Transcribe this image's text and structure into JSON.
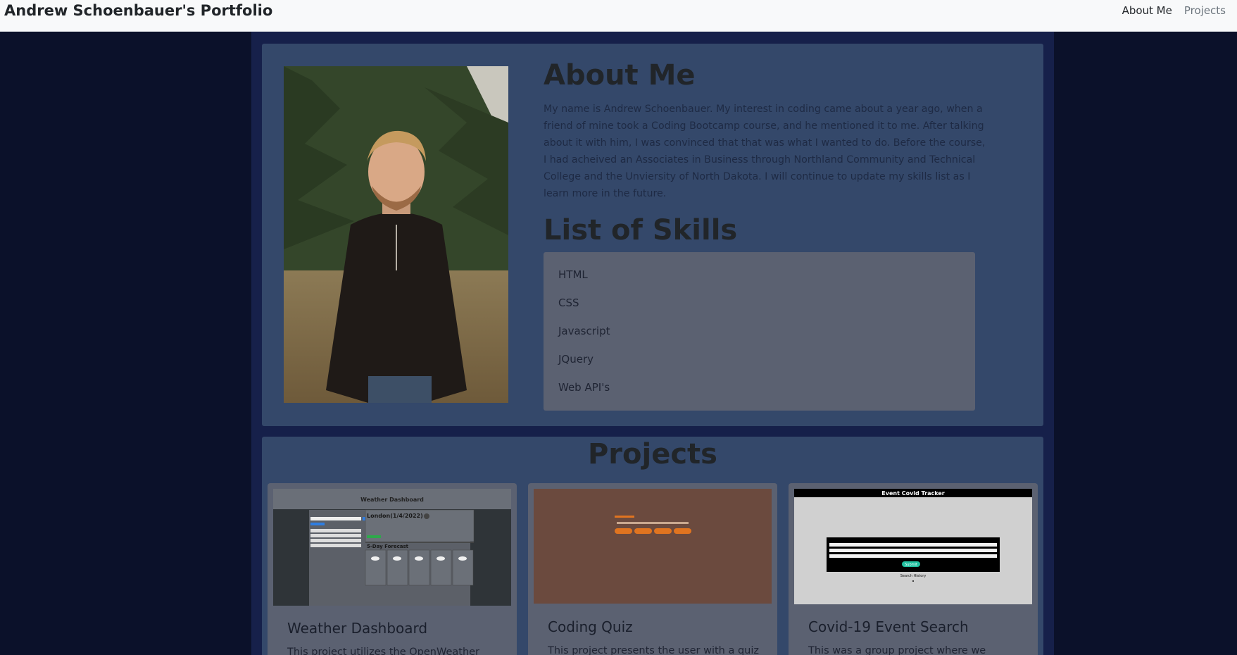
{
  "navbar": {
    "brand": "Andrew Schoenbauer's Portfolio",
    "links": [
      {
        "label": "About Me"
      },
      {
        "label": "Projects"
      }
    ]
  },
  "about": {
    "title": "About Me",
    "text": "My name is Andrew Schoenbauer. My interest in coding came about a year ago, when a friend of mine took a Coding Bootcamp course, and he mentioned it to me. After talking about it with him, I was convinced that that was what I wanted to do. Before the course, I had acheived an Associates in Business through Northland Community and Technical College and the Unviersity of North Dakota. I will continue to update my skills list as I learn more in the future."
  },
  "skills": {
    "title": "List of Skills",
    "items": [
      "HTML",
      "CSS",
      "Javascript",
      "JQuery",
      "Web API's"
    ]
  },
  "projects": {
    "title": "Projects",
    "cards": [
      {
        "title": "Weather Dashboard",
        "text": "This project utilizes the OpenWeather API",
        "preview": {
          "header": "Weather Dashboard",
          "city": "London(1/4/2022)",
          "forecast": "5-Day Forecast"
        }
      },
      {
        "title": "Coding Quiz",
        "text": "This project presents the user with a quiz"
      },
      {
        "title": "Covid-19 Event Search",
        "text": "This was a group project where we",
        "preview": {
          "header": "Event Covid Tracker",
          "history": "Search History",
          "button": "Submit"
        }
      }
    ]
  }
}
